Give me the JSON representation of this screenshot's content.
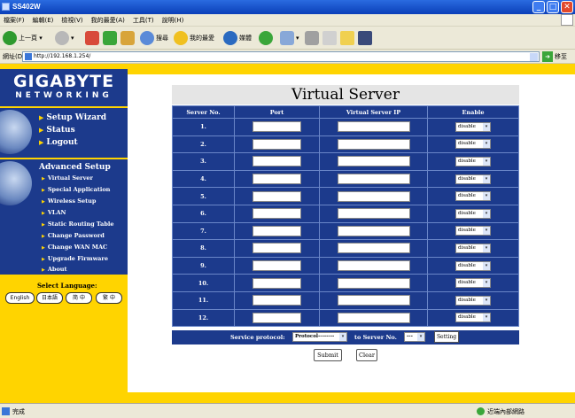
{
  "window": {
    "title": "SS402W",
    "min": "_",
    "max": "□",
    "close": "✕"
  },
  "menu": [
    "檔案(F)",
    "編輯(E)",
    "檢視(V)",
    "我的最愛(A)",
    "工具(T)",
    "說明(H)"
  ],
  "toolbar": {
    "back": "上一頁",
    "search": "搜尋",
    "favorites": "我的最愛",
    "media": "媒體"
  },
  "address": {
    "label": "網址(D)",
    "url": "http://192.168.1.254/",
    "go": "移至"
  },
  "logo": {
    "line1": "GIGABYTE",
    "line2": "NETWORKING"
  },
  "nav_main": [
    "Setup Wizard",
    "Status",
    "Logout"
  ],
  "nav_adv_title": "Advanced Setup",
  "nav_adv": [
    "Virtual Server",
    "Special Application",
    "Wireless Setup",
    "VLAN",
    "Static Routing Table",
    "Change Password",
    "Change WAN MAC",
    "Upgrade Firmware",
    "About"
  ],
  "select_language": "Select Language:",
  "languages": [
    "English",
    "日本語",
    "简 中",
    "繁 中"
  ],
  "page_title": "Virtual Server",
  "columns": [
    "Server No.",
    "Port",
    "Virtual Server IP",
    "Enable"
  ],
  "rows": [
    "1.",
    "2.",
    "3.",
    "4.",
    "5.",
    "6.",
    "7.",
    "8.",
    "9.",
    "10.",
    "11.",
    "12."
  ],
  "enable_value": "disable",
  "service_protocol_label": "Service protocol:",
  "protocol_value": "Protocol--------",
  "to_server_label": "to Server No.",
  "server_no_value": "---",
  "setting_button": "Setting",
  "submit_button": "Submit",
  "clear_button": "Clear",
  "status": {
    "left": "完成",
    "zone": "近端內部網路"
  }
}
